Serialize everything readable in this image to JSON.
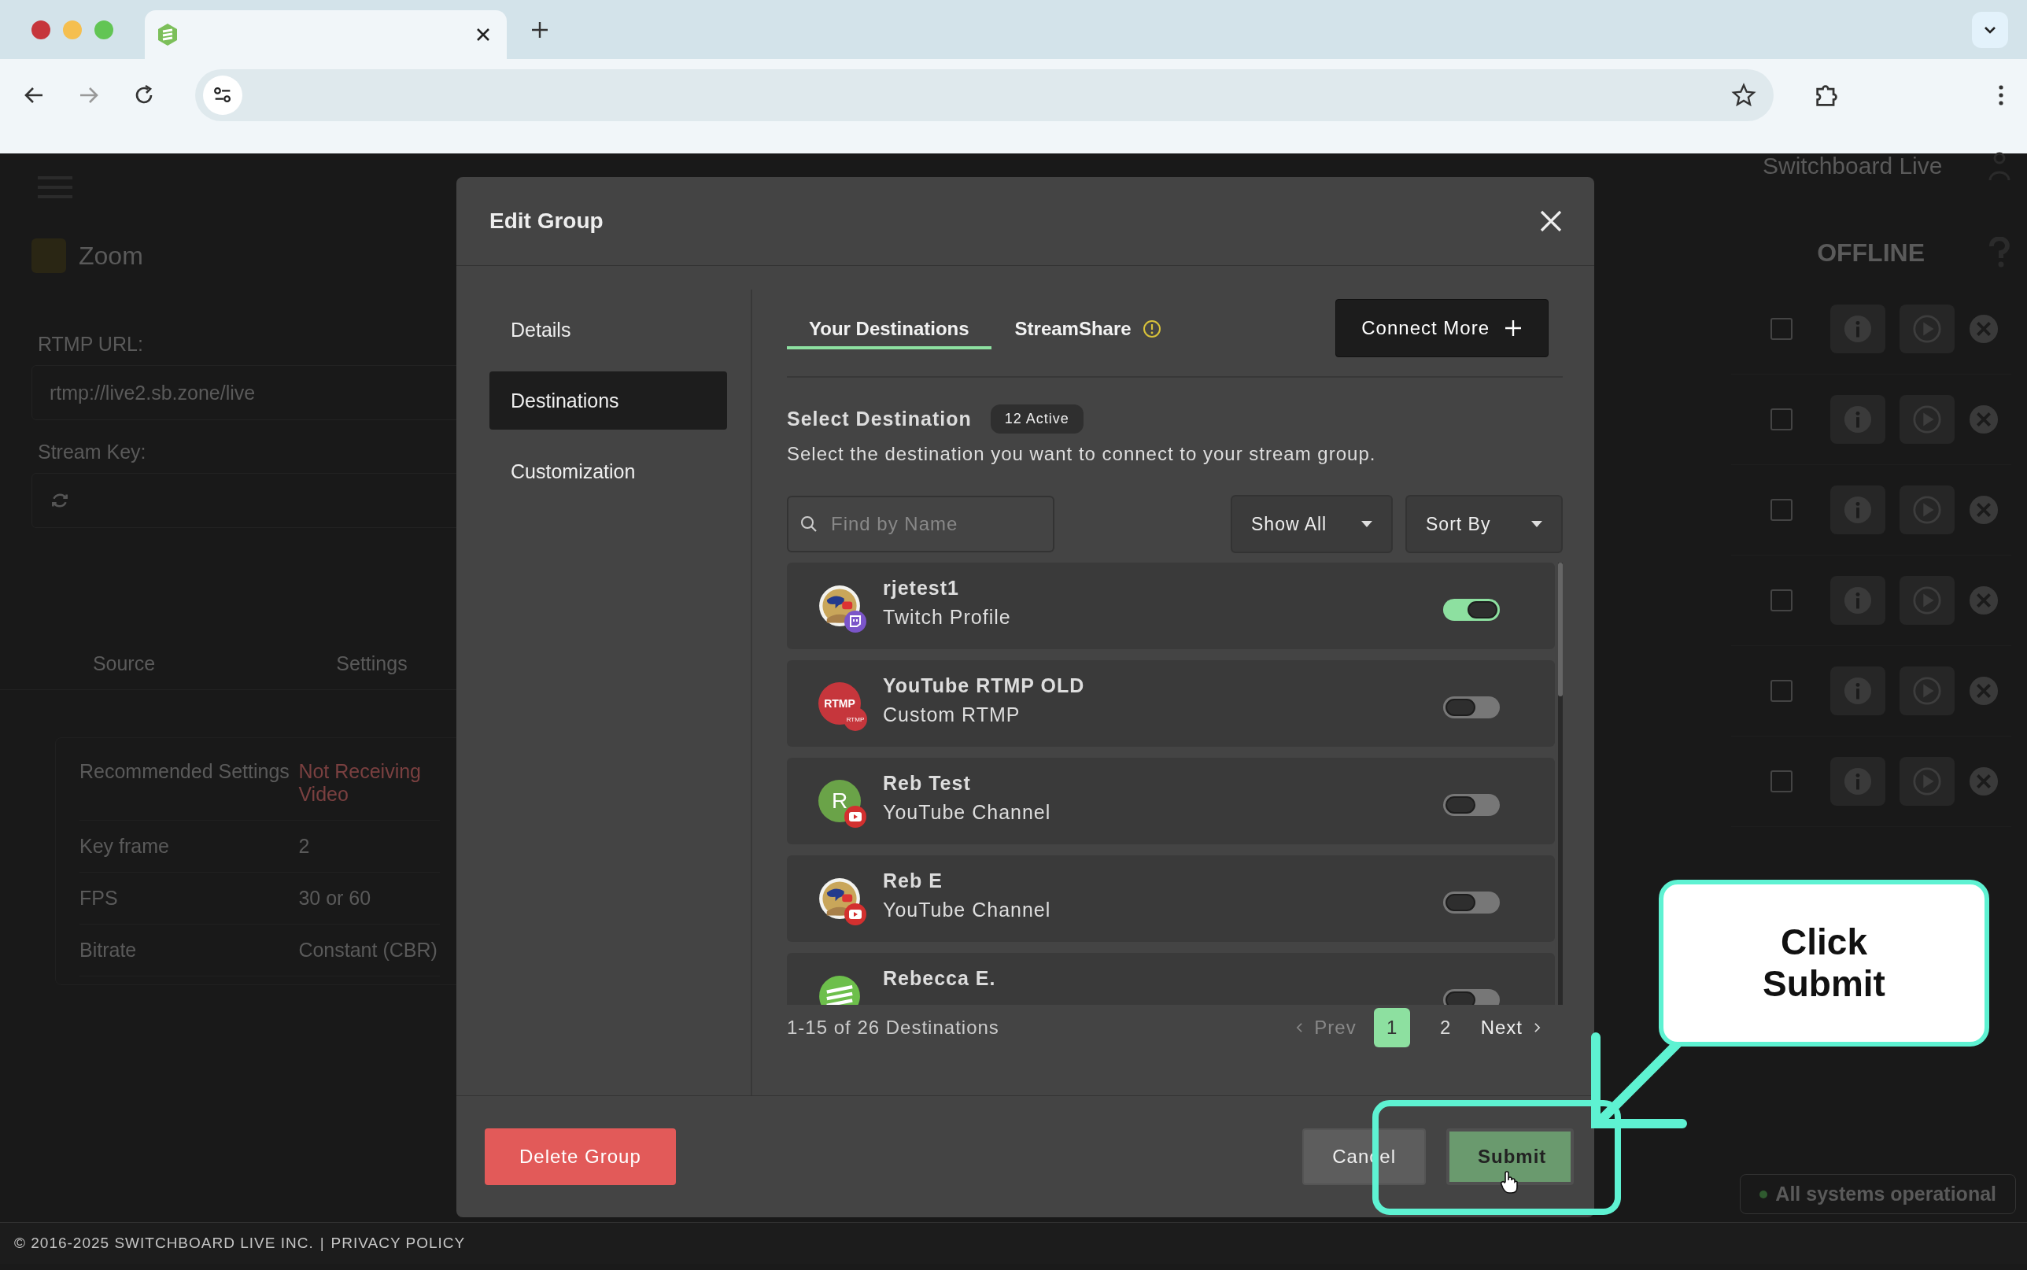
{
  "background": {
    "app_title": "Zoom",
    "account": "Switchboard Live",
    "rtmp_url_label": "RTMP URL:",
    "rtmp_url": "rtmp://live2.sb.zone/live",
    "stream_key_label": "Stream Key:",
    "tabs": [
      "Source",
      "Settings"
    ],
    "settings": [
      {
        "label": "Recommended Settings",
        "value": "Not Receiving Video",
        "kind": "warning"
      },
      {
        "label": "Key frame",
        "value": "2",
        "kind": "plain"
      },
      {
        "label": "FPS",
        "value": "30 or 60",
        "kind": "plain"
      },
      {
        "label": "Bitrate",
        "value": "Constant (CBR)",
        "kind": "plain"
      }
    ],
    "status": "OFFLINE",
    "system_status": "All systems operational",
    "rows": [
      {
        "checked": false
      },
      {
        "checked": false
      },
      {
        "checked": false
      },
      {
        "checked": false
      },
      {
        "checked": false
      },
      {
        "checked": false
      }
    ]
  },
  "modal": {
    "title": "Edit Group",
    "nav": [
      {
        "label": "Details",
        "selected": false
      },
      {
        "label": "Destinations",
        "selected": true
      },
      {
        "label": "Customization",
        "selected": false
      }
    ],
    "tabs": [
      {
        "label": "Your Destinations",
        "selected": true
      },
      {
        "label": "StreamShare",
        "selected": false
      }
    ],
    "connect_button": "Connect More",
    "section_title": "Select Destination",
    "active_badge": "12 Active",
    "description": "Select the destination you want to connect to your stream group.",
    "search": {
      "placeholder": "Find by Name"
    },
    "filter": "Show All",
    "sort": "Sort By",
    "destinations": [
      {
        "name": "rjetest1",
        "type": "Twitch Profile",
        "on": true,
        "avatar": {
          "kind": "image"
        },
        "badge": {
          "kind": "twitch"
        }
      },
      {
        "name": "YouTube RTMP OLD",
        "type": "Custom RTMP",
        "on": false,
        "avatar": {
          "kind": "rtmp",
          "text": "RTMP"
        },
        "badge": {
          "kind": "rtmp",
          "text": "RTMP"
        }
      },
      {
        "name": "Reb Test",
        "type": "YouTube Channel",
        "on": false,
        "avatar": {
          "kind": "letter",
          "text": "R"
        },
        "badge": {
          "kind": "youtube"
        }
      },
      {
        "name": "Reb E",
        "type": "YouTube Channel",
        "on": false,
        "avatar": {
          "kind": "image"
        },
        "badge": {
          "kind": "youtube"
        }
      },
      {
        "name": "Rebecca E.",
        "on": false,
        "avatar": {
          "kind": "logo"
        }
      }
    ],
    "range": "1-15 of 26 Destinations",
    "pagination": {
      "prev": "Prev",
      "pages": [
        {
          "label": "1",
          "selected": true
        },
        {
          "label": "2",
          "selected": false
        }
      ],
      "next": "Next"
    },
    "delete_button": "Delete Group",
    "cancel_button": "Cancel",
    "submit_button": "Submit"
  },
  "callout": {
    "text": "Click Submit"
  },
  "footer": {
    "copyright": "© 2016-2025 SWITCHBOARD LIVE INC.",
    "separator": "|",
    "link": "PRIVACY POLICY"
  }
}
